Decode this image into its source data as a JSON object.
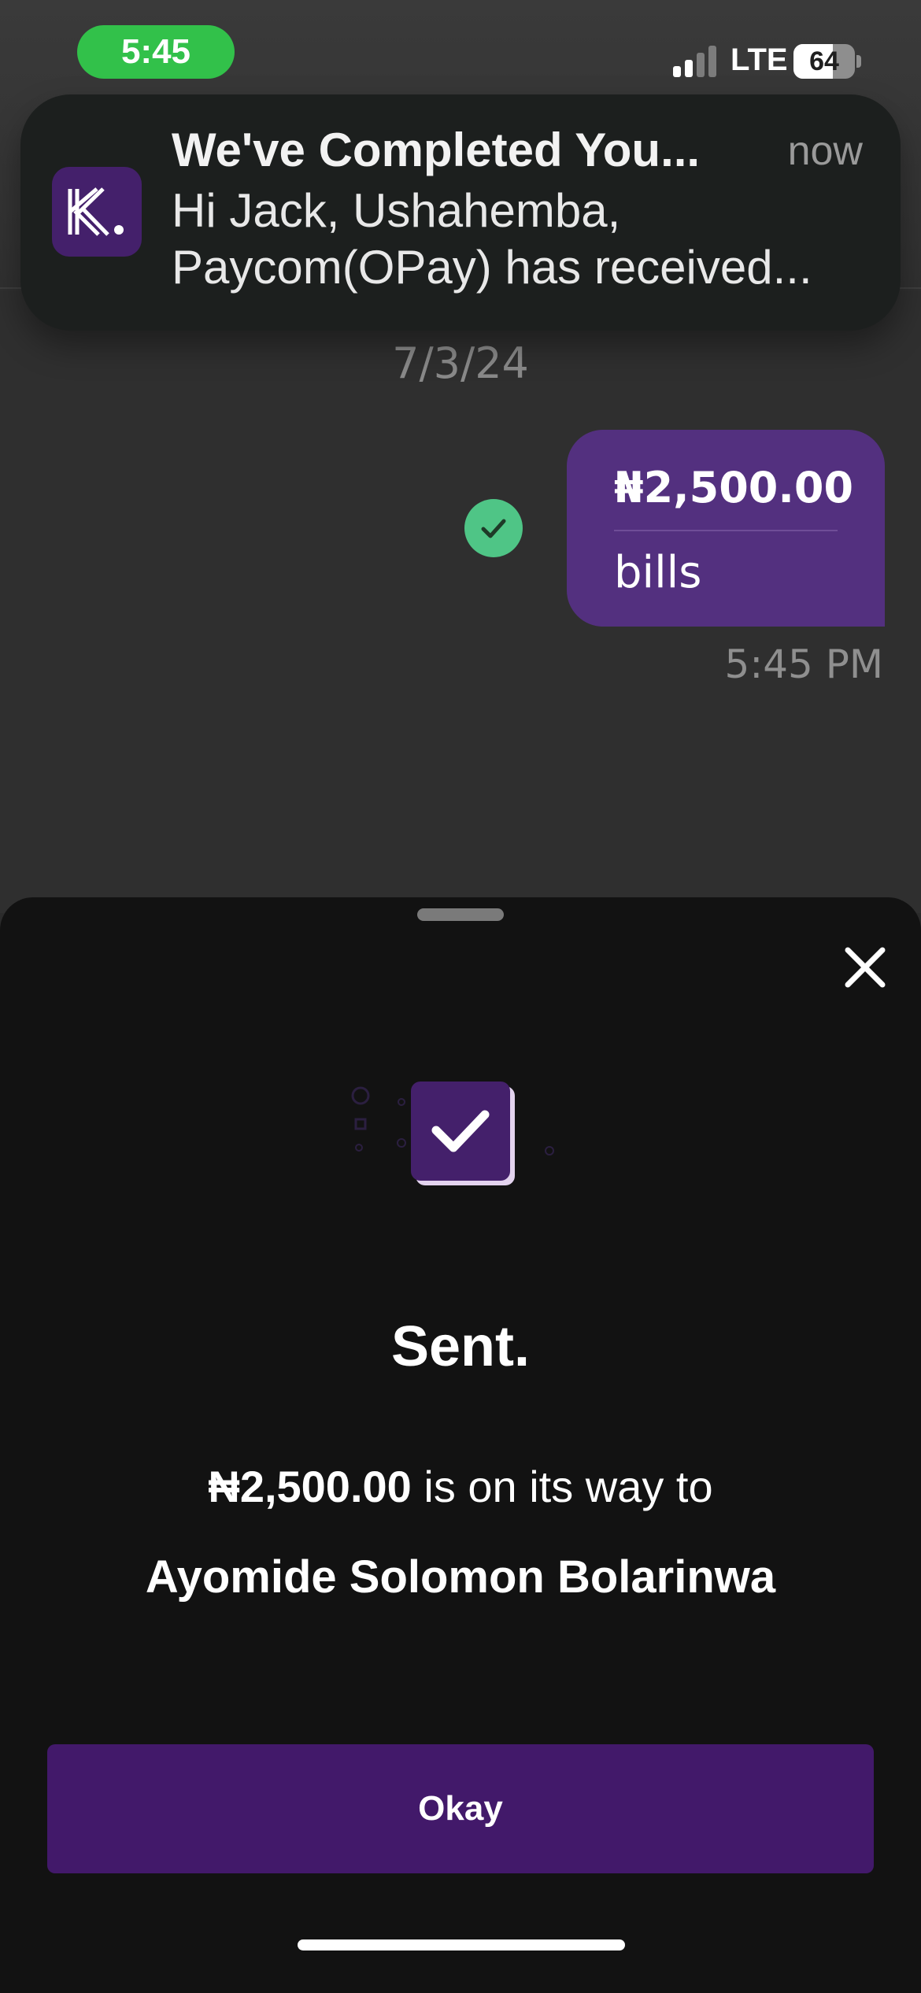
{
  "status_bar": {
    "time": "5:45",
    "network": "LTE",
    "battery_level": "64",
    "battery_fraction": 0.64,
    "time_pill_color": "#32c14a"
  },
  "notification": {
    "app_icon": "kuda-k-logo-icon",
    "title": "We've Completed You...",
    "time": "now",
    "body": "Hi Jack, Ushahemba, Paycom(OPay) has received..."
  },
  "chat": {
    "date": "7/3/24",
    "message": {
      "amount": "₦2,500.00",
      "note": "bills",
      "time": "5:45 PM",
      "status_icon": "delivered-check-icon"
    }
  },
  "sheet": {
    "heading": "Sent.",
    "amount": "₦2,500.00",
    "line_suffix": " is on its way to",
    "recipient": "Ayomide Solomon Bolarinwa",
    "okay_label": "Okay",
    "close_icon": "close-icon",
    "success_icon": "checkbox-check-icon"
  },
  "colors": {
    "brand_purple": "#42196a",
    "bubble_purple": "#53307f",
    "success_green": "#4fc586",
    "sheet_background": "#121212"
  }
}
